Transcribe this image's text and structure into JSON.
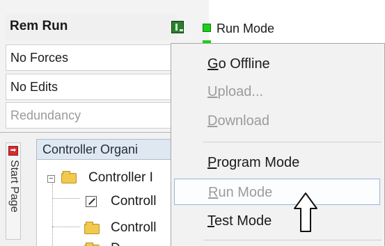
{
  "status": {
    "mode": "Rem Run",
    "forces": "No Forces",
    "edits": "No Edits",
    "redundancy": "Redundancy",
    "run_mode_label": "Run Mode"
  },
  "organizer": {
    "start_tab_label": "Start Page",
    "header": "Controller Organi",
    "tree": [
      {
        "label": "Controller I"
      },
      {
        "label": "Controll"
      },
      {
        "label": "Controll"
      },
      {
        "label": "D"
      }
    ]
  },
  "context_menu": {
    "items": [
      {
        "accel": "G",
        "rest": "o Offline",
        "enabled": true
      },
      {
        "accel": "U",
        "rest": "pload...",
        "enabled": false
      },
      {
        "accel": "D",
        "rest": "ownload",
        "enabled": false
      },
      {
        "accel": "P",
        "rest": "rogram Mode",
        "enabled": true
      },
      {
        "accel": "R",
        "rest": "un Mode",
        "enabled": false,
        "highlighted": true
      },
      {
        "accel": "T",
        "rest": "est Mode",
        "enabled": true
      }
    ]
  },
  "icons": {
    "controller_status": "controller-status-icon",
    "run_led": "green-led-icon",
    "start_page": "start-page-icon",
    "folder": "folder-icon",
    "properties": "controller-properties-icon",
    "pointer_arrow": "up-arrow-icon"
  },
  "colors": {
    "run_led": "#19d119",
    "menu_highlight_border": "#8fb8de",
    "disabled_text": "#9c9c9c",
    "organizer_header": "#dfe7f1"
  }
}
